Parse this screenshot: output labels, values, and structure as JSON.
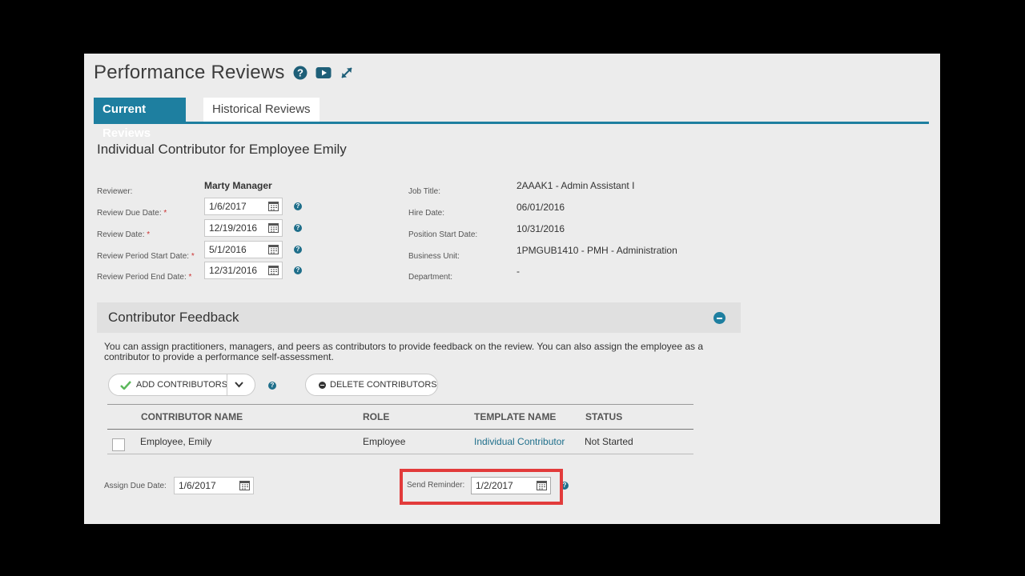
{
  "header": {
    "title": "Performance Reviews",
    "icons": [
      "help-icon",
      "video-icon",
      "expand-icon"
    ]
  },
  "tabs": [
    {
      "label": "Current Reviews",
      "active": true
    },
    {
      "label": "Historical Reviews",
      "active": false
    }
  ],
  "review": {
    "title": "Individual Contributor for Employee Emily",
    "reviewer_label": "Reviewer:",
    "reviewer_value": "Marty Manager",
    "due_date_label": "Review Due Date:",
    "due_date_value": "1/6/2017",
    "review_date_label": "Review Date:",
    "review_date_value": "12/19/2016",
    "period_start_label": "Review Period Start Date:",
    "period_start_value": "5/1/2016",
    "period_end_label": "Review Period End Date:",
    "period_end_value": "12/31/2016",
    "required_marker": "*",
    "job_title_label": "Job Title:",
    "job_title_value": "2AAAK1 - Admin Assistant I",
    "hire_date_label": "Hire Date:",
    "hire_date_value": "06/01/2016",
    "position_start_label": "Position Start Date:",
    "position_start_value": "10/31/2016",
    "business_unit_label": "Business Unit:",
    "business_unit_value": "1PMGUB1410 - PMH - Administration",
    "department_label": "Department:",
    "department_value": "-"
  },
  "contributors": {
    "title": "Contributor Feedback",
    "description": "You can assign practitioners, managers, and peers as contributors to provide feedback on the review. You can also assign the employee as a contributor to provide a performance self-assessment.",
    "add_label": "ADD CONTRIBUTORS",
    "delete_label": "DELETE CONTRIBUTORS",
    "columns": [
      "CONTRIBUTOR NAME",
      "ROLE",
      "TEMPLATE NAME",
      "STATUS"
    ],
    "rows": [
      {
        "name": "Employee, Emily",
        "role": "Employee",
        "template": "Individual Contributor",
        "status": "Not Started"
      }
    ],
    "assign_due_label": "Assign Due Date:",
    "assign_due_value": "1/6/2017",
    "send_reminder_label": "Send Reminder:",
    "send_reminder_value": "1/2/2017"
  },
  "colors": {
    "accent": "#1e7fa0",
    "highlight": "#e23b3b",
    "link": "#1f6f8b"
  }
}
